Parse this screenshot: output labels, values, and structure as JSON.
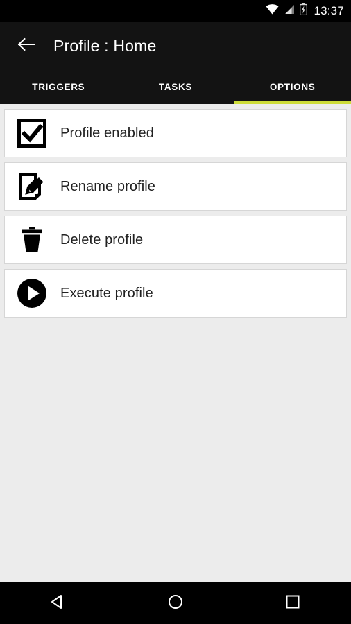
{
  "status_bar": {
    "time": "13:37",
    "icons": [
      "wifi-icon",
      "cellular-signal-icon",
      "battery-charging-icon"
    ],
    "background_color": "#000000"
  },
  "app_bar": {
    "back_label": "back-arrow-icon",
    "title": "Profile : Home",
    "background_color": "#131313"
  },
  "tabs": {
    "active_index": 2,
    "indicator_color": "#cddc39",
    "items": [
      {
        "label": "TRIGGERS"
      },
      {
        "label": "TASKS"
      },
      {
        "label": "OPTIONS"
      }
    ]
  },
  "options_list": {
    "background_color": "#ececec",
    "items": [
      {
        "label": "Profile enabled",
        "icon": "checkbox-checked-icon",
        "checked": true
      },
      {
        "label": "Rename profile",
        "icon": "edit-document-icon"
      },
      {
        "label": "Delete profile",
        "icon": "trash-icon"
      },
      {
        "label": "Execute profile",
        "icon": "play-circle-icon"
      }
    ]
  },
  "nav_bar": {
    "buttons": [
      {
        "name": "back",
        "icon": "triangle-back-icon"
      },
      {
        "name": "home",
        "icon": "circle-home-icon"
      },
      {
        "name": "recents",
        "icon": "square-recents-icon"
      }
    ],
    "background_color": "#000000"
  }
}
